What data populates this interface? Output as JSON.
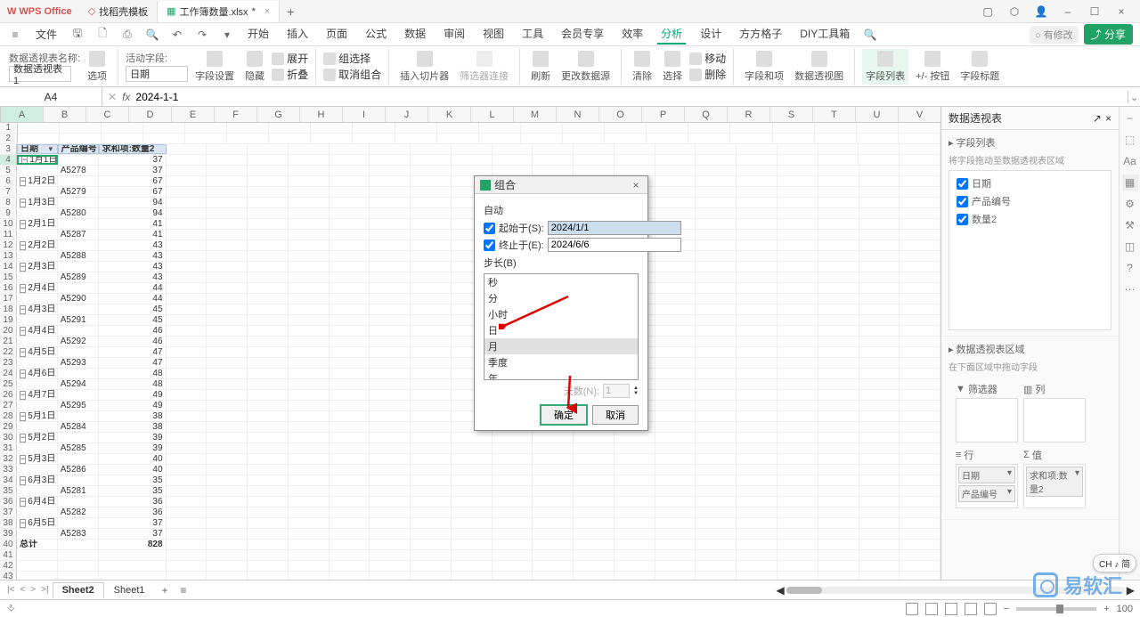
{
  "titlebar": {
    "app": "WPS Office",
    "tabs": [
      {
        "label": "找稻壳模板",
        "icon": "doc-icon"
      },
      {
        "label": "工作簿数量.xlsx",
        "icon": "sheet-icon",
        "dirty": "*"
      }
    ]
  },
  "menubar": {
    "file": "文件",
    "items": [
      "开始",
      "插入",
      "页面",
      "公式",
      "数据",
      "审阅",
      "视图",
      "工具",
      "会员专享",
      "效率",
      "分析",
      "设计",
      "方方格子",
      "DIY工具箱"
    ],
    "status": "有修改",
    "share": "分享"
  },
  "ribbon": {
    "name_label": "数据透视表名称:",
    "name_value": "数据透视表1",
    "options": "选项",
    "active_field_label": "活动字段:",
    "active_field_value": "日期",
    "field_settings": "字段设置",
    "hide": "隐藏",
    "expand": "展开",
    "collapse": "折叠",
    "group_sel": "组选择",
    "ungroup": "取消组合",
    "insert_slicer": "插入切片器",
    "filter_conn": "筛选器连接",
    "refresh": "刷新",
    "change_source": "更改数据源",
    "clear": "清除",
    "select": "选择",
    "move": "移动",
    "delete": "删除",
    "fields_calc": "字段和项",
    "pivot_chart": "数据透视图",
    "field_list": "字段列表",
    "pm_btn": "+/- 按钮",
    "field_headers": "字段标题"
  },
  "formula": {
    "name_box": "A4",
    "value": "2024-1-1"
  },
  "columns": [
    "A",
    "B",
    "C",
    "D",
    "E",
    "F",
    "G",
    "H",
    "I",
    "J",
    "K",
    "L",
    "M",
    "N",
    "O",
    "P",
    "Q",
    "R",
    "S",
    "T",
    "U",
    "V"
  ],
  "headers": {
    "date": "日期",
    "product": "产品编号",
    "sum": "求和项:数量2"
  },
  "rows": [
    {
      "n": 3,
      "a": "日期",
      "b": "产品编号",
      "c": "求和项:数量2",
      "hdr": true
    },
    {
      "n": 4,
      "a": "1月1日",
      "c": 37,
      "grp": true,
      "sel": true
    },
    {
      "n": 5,
      "b": "A5278",
      "c": 37
    },
    {
      "n": 6,
      "a": "1月2日",
      "c": 67,
      "grp": true
    },
    {
      "n": 7,
      "b": "A5279",
      "c": 67
    },
    {
      "n": 8,
      "a": "1月3日",
      "c": 94,
      "grp": true
    },
    {
      "n": 9,
      "b": "A5280",
      "c": 94
    },
    {
      "n": 10,
      "a": "2月1日",
      "c": 41,
      "grp": true
    },
    {
      "n": 11,
      "b": "A5287",
      "c": 41
    },
    {
      "n": 12,
      "a": "2月2日",
      "c": 43,
      "grp": true
    },
    {
      "n": 13,
      "b": "A5288",
      "c": 43
    },
    {
      "n": 14,
      "a": "2月3日",
      "c": 43,
      "grp": true
    },
    {
      "n": 15,
      "b": "A5289",
      "c": 43
    },
    {
      "n": 16,
      "a": "2月4日",
      "c": 44,
      "grp": true
    },
    {
      "n": 17,
      "b": "A5290",
      "c": 44
    },
    {
      "n": 18,
      "a": "4月3日",
      "c": 45,
      "grp": true
    },
    {
      "n": 19,
      "b": "A5291",
      "c": 45
    },
    {
      "n": 20,
      "a": "4月4日",
      "c": 46,
      "grp": true
    },
    {
      "n": 21,
      "b": "A5292",
      "c": 46
    },
    {
      "n": 22,
      "a": "4月5日",
      "c": 47,
      "grp": true
    },
    {
      "n": 23,
      "b": "A5293",
      "c": 47
    },
    {
      "n": 24,
      "a": "4月6日",
      "c": 48,
      "grp": true
    },
    {
      "n": 25,
      "b": "A5294",
      "c": 48
    },
    {
      "n": 26,
      "a": "4月7日",
      "c": 49,
      "grp": true
    },
    {
      "n": 27,
      "b": "A5295",
      "c": 49
    },
    {
      "n": 28,
      "a": "5月1日",
      "c": 38,
      "grp": true
    },
    {
      "n": 29,
      "b": "A5284",
      "c": 38
    },
    {
      "n": 30,
      "a": "5月2日",
      "c": 39,
      "grp": true
    },
    {
      "n": 31,
      "b": "A5285",
      "c": 39
    },
    {
      "n": 32,
      "a": "5月3日",
      "c": 40,
      "grp": true
    },
    {
      "n": 33,
      "b": "A5286",
      "c": 40
    },
    {
      "n": 34,
      "a": "6月3日",
      "c": 35,
      "grp": true
    },
    {
      "n": 35,
      "b": "A5281",
      "c": 35
    },
    {
      "n": 36,
      "a": "6月4日",
      "c": 36,
      "grp": true
    },
    {
      "n": 37,
      "b": "A5282",
      "c": 36
    },
    {
      "n": 38,
      "a": "6月5日",
      "c": 37,
      "grp": true
    },
    {
      "n": 39,
      "b": "A5283",
      "c": 37
    },
    {
      "n": 40,
      "a": "总计",
      "c": 828,
      "total": true
    },
    {
      "n": 41
    },
    {
      "n": 42
    },
    {
      "n": 43
    }
  ],
  "panel": {
    "title": "数据透视表",
    "field_list": "字段列表",
    "drag_hint": "将字段拖动至数据透视表区域",
    "fields": [
      "日期",
      "产品编号",
      "数量2"
    ],
    "areas_title": "数据透视表区域",
    "areas_hint": "在下面区域中拖动字段",
    "filter": "筛选器",
    "columns": "列",
    "rows_area": "行",
    "values": "值",
    "row_items": [
      "日期",
      "产品编号"
    ],
    "value_items": [
      "求和项:数量2"
    ]
  },
  "dialog": {
    "title": "组合",
    "auto": "自动",
    "start_label": "起始于(S):",
    "start_value": "2024/1/1",
    "end_label": "终止于(E):",
    "end_value": "2024/6/6",
    "step_label": "步长(B)",
    "options": [
      "秒",
      "分",
      "小时",
      "日",
      "月",
      "季度",
      "年"
    ],
    "selected": "月",
    "days_label": "天数(N):",
    "days_value": "1",
    "ok": "确定",
    "cancel": "取消"
  },
  "sheets": {
    "tabs": [
      "Sheet2",
      "Sheet1"
    ],
    "active": "Sheet2"
  },
  "statusbar": {
    "zoom": "100"
  },
  "ime": "CH ♪ 简",
  "watermark": "易软汇"
}
